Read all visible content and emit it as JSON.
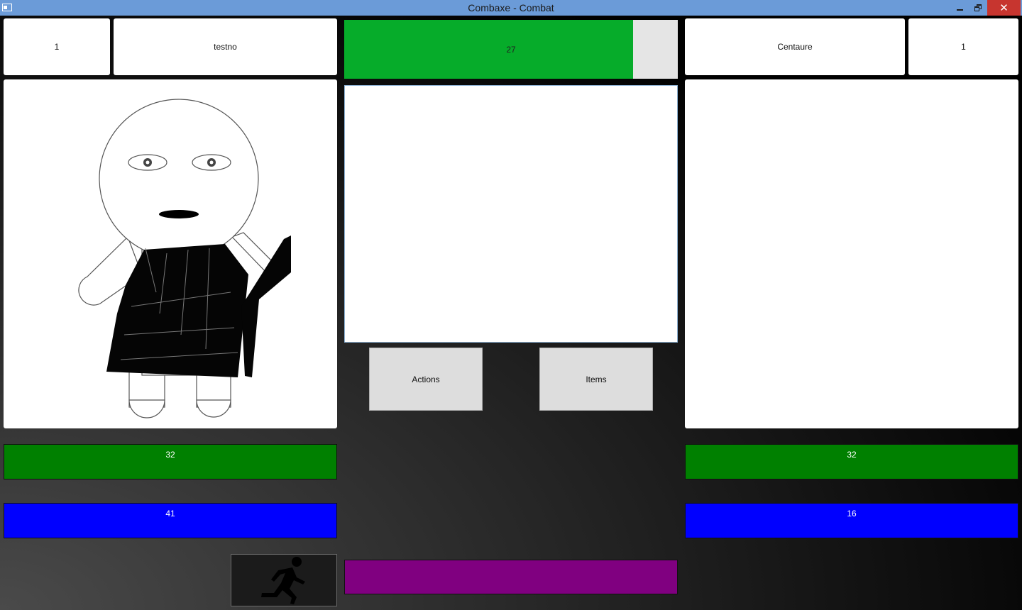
{
  "window": {
    "title": "Combaxe - Combat",
    "titlebar_color": "#6b9bd8",
    "close_color": "#c7352f"
  },
  "player": {
    "level": "1",
    "name": "testno",
    "portrait": "stick-figure-warrior",
    "hp": "32",
    "mp": "41"
  },
  "enemy": {
    "name": "Centaure",
    "level": "1",
    "hp": "32",
    "mp": "16"
  },
  "turn_timer": {
    "value": "27",
    "fill": 0.866,
    "color": "#06ac2a"
  },
  "commands": {
    "actions_label": "Actions",
    "items_label": "Items"
  },
  "flee": {
    "icon": "running-man-icon"
  },
  "colors": {
    "hp": "#008000",
    "mp": "#0000ff",
    "status_bar": "#800080"
  }
}
